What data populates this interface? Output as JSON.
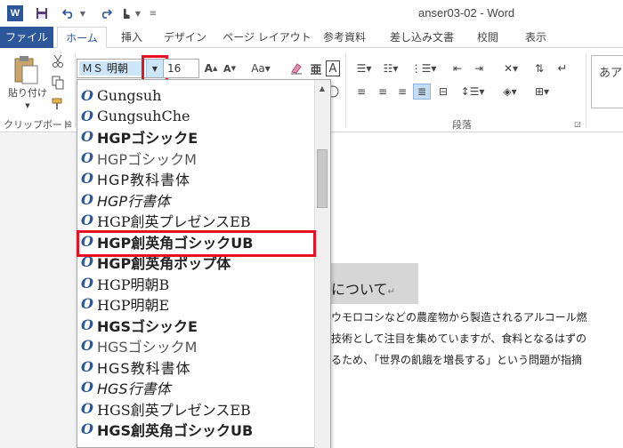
{
  "window": {
    "title": "anser03-02 - Word",
    "app_icon": "W"
  },
  "tabs": [
    {
      "label": "ファイル"
    },
    {
      "label": "ホーム"
    },
    {
      "label": "挿入"
    },
    {
      "label": "デザイン"
    },
    {
      "label": "ページ レイアウト"
    },
    {
      "label": "参考資料"
    },
    {
      "label": "差し込み文書"
    },
    {
      "label": "校閲"
    },
    {
      "label": "表示"
    }
  ],
  "ribbon": {
    "paste_label": "貼り付け",
    "clipboard_group": "クリップボード",
    "paragraph_group": "段落",
    "font_name": "ＭＳ 明朝",
    "font_size": "16",
    "style_preview": "あア"
  },
  "font_list": [
    {
      "name": "Gungsuh"
    },
    {
      "name": "GungsuhChe"
    },
    {
      "name": "HGPゴシックE"
    },
    {
      "name": "HGPゴシックM"
    },
    {
      "name": "HGP教科書体"
    },
    {
      "name": "HGP行書体"
    },
    {
      "name": "HGP創英プレゼンスEB"
    },
    {
      "name": "HGP創英角ゴシックUB"
    },
    {
      "name": "HGP創英角ポップ体"
    },
    {
      "name": "HGP明朝B"
    },
    {
      "name": "HGP明朝E"
    },
    {
      "name": "HGSゴシックE"
    },
    {
      "name": "HGSゴシックM"
    },
    {
      "name": "HGS教科書体"
    },
    {
      "name": "HGS行書体"
    },
    {
      "name": "HGS創英プレゼンスEB"
    },
    {
      "name": "HGS創英角ゴシックUB"
    }
  ],
  "document": {
    "heading_fragment": "について",
    "lines": [
      "ウモロコシなどの農産物から製造されるアルコール燃",
      "技術として注目を集めていますが、食料となるはずの",
      "るため、「世界の飢餓を増長する」という問題が指摘"
    ]
  },
  "colors": {
    "accent": "#2b579a",
    "highlight": "#e81123"
  }
}
